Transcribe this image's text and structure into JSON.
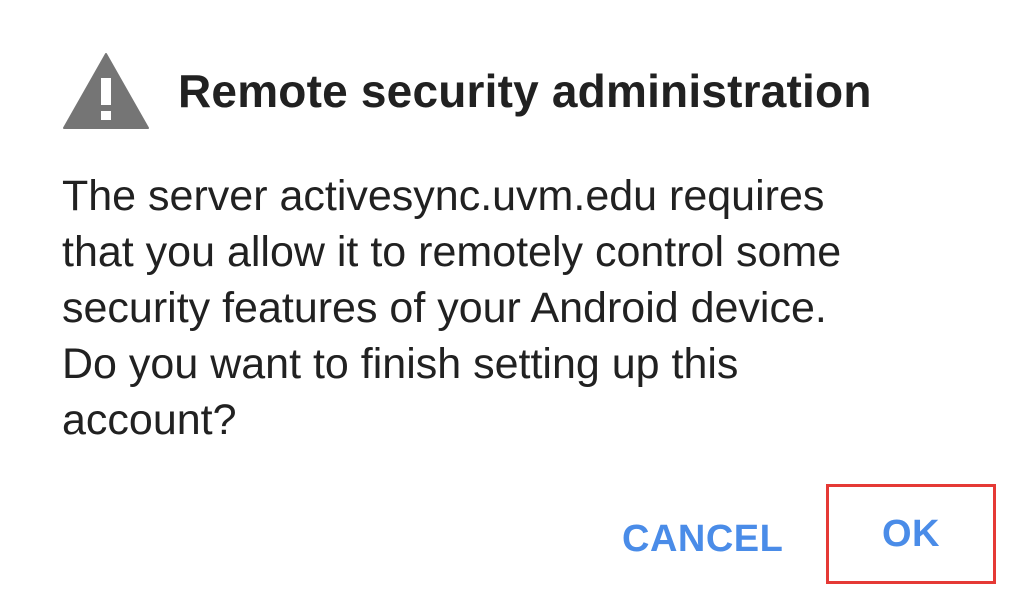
{
  "dialog": {
    "icon": "warning-triangle-icon",
    "title": "Remote security administration",
    "message_lines": [
      "The server activesync.uvm.edu requires",
      "that you allow it to remotely control some",
      "security features of your Android device.",
      "Do you want to finish setting up this",
      "account?"
    ],
    "cancel_label": "CANCEL",
    "ok_label": "OK"
  },
  "colors": {
    "text": "#212121",
    "icon": "#757575",
    "button": "#4a8ce8",
    "highlight_border": "#e53935"
  }
}
